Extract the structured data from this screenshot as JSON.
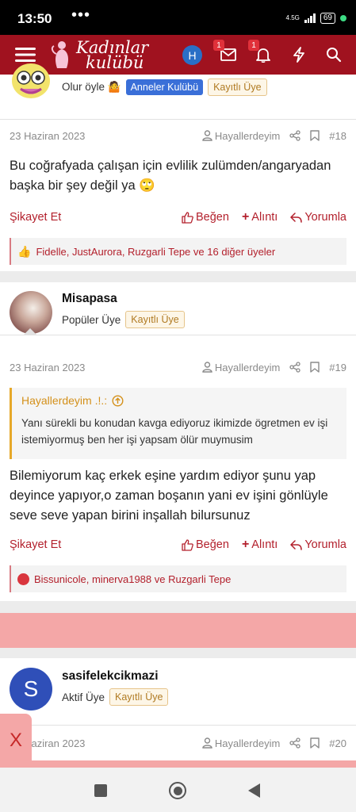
{
  "status_bar": {
    "time": "13:50",
    "dots": "•••",
    "net": "4.5G",
    "battery": "69"
  },
  "header": {
    "logo_line1": "Kadınlar",
    "logo_line2": "kulübü",
    "avatar_letter": "H",
    "messages_count": "1",
    "alerts_count": "1"
  },
  "post1": {
    "user_title": "Olur öyle 🤷",
    "badge_group": "Anneler Kulübü",
    "badge_member": "Kayıtlı Üye",
    "date": "23 Haziran 2023",
    "quoted_user": "Hayallerdeyim",
    "post_num": "#18",
    "text": "Bu coğrafyada çalışan için evlilik zulümden/angaryadan başka bir şey değil ya 🙄",
    "report": "Şikayet Et",
    "like": "Beğen",
    "quote": "Alıntı",
    "reply": "Yorumla",
    "likes_text": "Fidelle, JustAurora, Ruzgarli Tepe ve 16 diğer üyeler"
  },
  "post2": {
    "username": "Misapasa",
    "user_title": "Popüler Üye",
    "badge_member": "Kayıtlı Üye",
    "date": "23 Haziran 2023",
    "quoted_user": "Hayallerdeyim",
    "post_num": "#19",
    "quote_author": "Hayallerdeyim .!.:",
    "quote_text": "Yanı sürekli bu konudan kavga ediyoruz ikimizde ögretmen ev işi istemiyormuş ben her işi yapsam ölür muymusim",
    "text": "Bilemiyorum kaç erkek eşine yardım ediyor şunu yap deyince yapıyor,o zaman boşanın yani ev işini gönlüyle seve seve yapan birini inşallah bilursunuz",
    "report": "Şikayet Et",
    "like": "Beğen",
    "quote": "Alıntı",
    "reply": "Yorumla",
    "likes_text": "Bissunicole, minerva1988 ve Ruzgarli Tepe"
  },
  "post3": {
    "avatar_letter": "S",
    "username": "sasifelekcikmazi",
    "user_title": "Aktif Üye",
    "badge_member": "Kayıtlı Üye",
    "date": "23 Haziran 2023",
    "quoted_user": "Hayallerdeyim",
    "post_num": "#20"
  },
  "ad_close": "X",
  "colors": {
    "brand": "#a0121f",
    "action": "#b3202c",
    "quote_accent": "#e6a829",
    "group_badge": "#3a6fd8",
    "ad_band": "#f4a7a7"
  }
}
